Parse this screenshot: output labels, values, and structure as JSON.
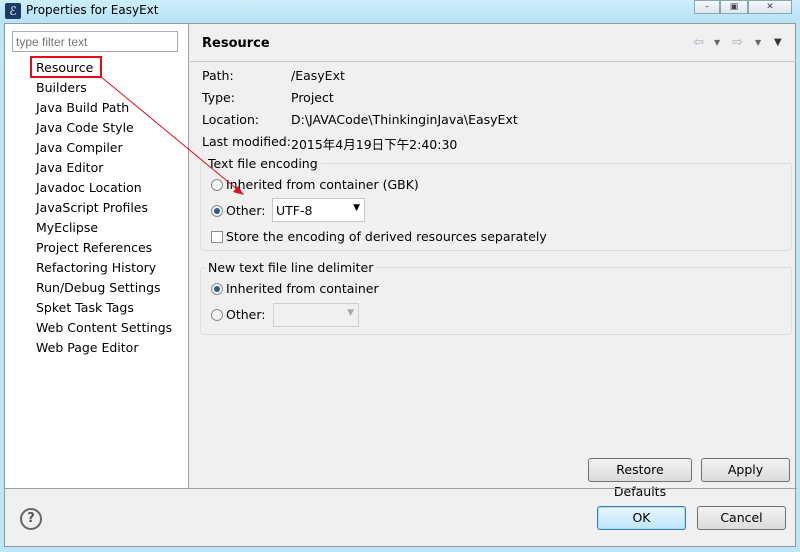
{
  "window": {
    "title": "Properties for EasyExt",
    "icon": "eclipse-app-icon",
    "minimize": "minimize-icon",
    "maximize": "maximize-icon",
    "close": "close-icon"
  },
  "sidebar": {
    "filter_placeholder": "type filter text",
    "items": [
      {
        "label": "Resource",
        "selected": true
      },
      {
        "label": "Builders"
      },
      {
        "label": "Java Build Path"
      },
      {
        "label": "Java Code Style"
      },
      {
        "label": "Java Compiler"
      },
      {
        "label": "Java Editor"
      },
      {
        "label": "Javadoc Location"
      },
      {
        "label": "JavaScript Profiles"
      },
      {
        "label": "MyEclipse"
      },
      {
        "label": "Project References"
      },
      {
        "label": "Refactoring History"
      },
      {
        "label": "Run/Debug Settings"
      },
      {
        "label": "Spket Task Tags"
      },
      {
        "label": "Web Content Settings"
      },
      {
        "label": "Web Page Editor"
      }
    ]
  },
  "page": {
    "title": "Resource",
    "info": [
      {
        "label": "Path:",
        "value": "/EasyExt"
      },
      {
        "label": "Type:",
        "value": "Project"
      },
      {
        "label": "Location:",
        "value": "D:\\JAVACode\\ThinkinginJava\\EasyExt"
      },
      {
        "label": "Last modified:",
        "value": "2015年4月19日下午2:40:30"
      }
    ],
    "encoding": {
      "legend": "Text file encoding",
      "inherited": "Inherited from container (GBK)",
      "other": "Other:",
      "other_value": "UTF-8",
      "selected": "other",
      "store_label": "Store the encoding of derived resources separately",
      "store_checked": false
    },
    "delimiter": {
      "legend": "New text file line delimiter",
      "inherited": "Inherited from container",
      "other": "Other:",
      "other_value": "",
      "selected": "inherited"
    },
    "restore_defaults": "Restore Defaults",
    "apply": "Apply"
  },
  "footer": {
    "ok": "OK",
    "cancel": "Cancel",
    "help": "?"
  },
  "annotation": {
    "color": "#e0101a"
  }
}
